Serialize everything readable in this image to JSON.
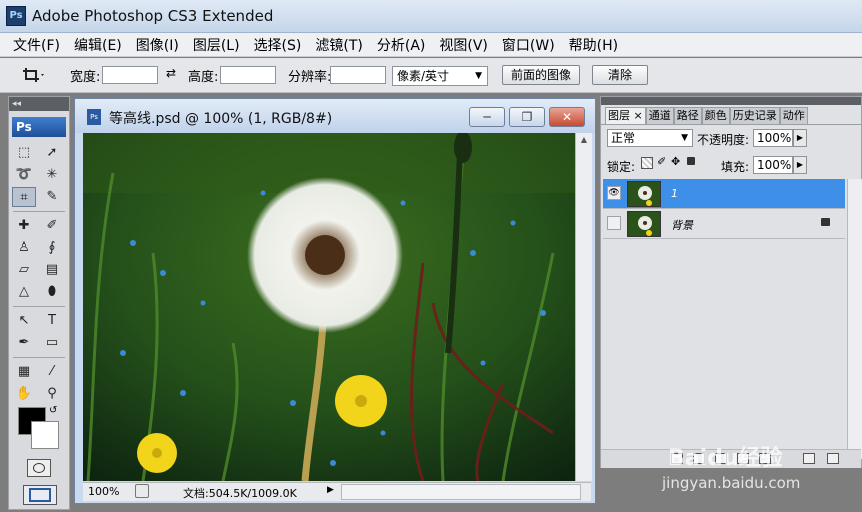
{
  "titlebar": {
    "app_icon": "Ps",
    "title": "Adobe Photoshop CS3 Extended"
  },
  "menu": [
    "文件(F)",
    "编辑(E)",
    "图像(I)",
    "图层(L)",
    "选择(S)",
    "滤镜(T)",
    "分析(A)",
    "视图(V)",
    "窗口(W)",
    "帮助(H)"
  ],
  "options": {
    "width_label": "宽度:",
    "height_label": "高度:",
    "resolution_label": "分辨率:",
    "unit_select": "像素/英寸",
    "front_image_button": "前面的图像",
    "clear_button": "清除"
  },
  "tools": {
    "logo": "Ps",
    "collapse": "◂◂"
  },
  "document": {
    "icon": "Ps",
    "title": "等高线.psd @ 100% (1, RGB/8#)",
    "minimize": "─",
    "restore": "❐",
    "close": "✕",
    "zoom": "100%",
    "doc_info": "文档:504.5K/1009.0K"
  },
  "layers_panel": {
    "tabs": [
      "图层",
      "通道",
      "路径",
      "颜色",
      "历史记录",
      "动作"
    ],
    "tab_close": "×",
    "blend_mode": "正常",
    "opacity_label": "不透明度:",
    "opacity_value": "100%",
    "lock_label": "锁定:",
    "fill_label": "填充:",
    "fill_value": "100%",
    "layers": [
      {
        "name": "1",
        "visible": true,
        "selected": true,
        "locked": false
      },
      {
        "name": "背景",
        "visible": false,
        "selected": false,
        "locked": true
      }
    ]
  },
  "watermark": {
    "line1": "Baidu经验",
    "line2": "jingyan.baidu.com"
  },
  "colors": {
    "foreground": "#000000",
    "background": "#ffffff",
    "selection": "#3d8fe8",
    "close_button": "#c84a2f"
  }
}
